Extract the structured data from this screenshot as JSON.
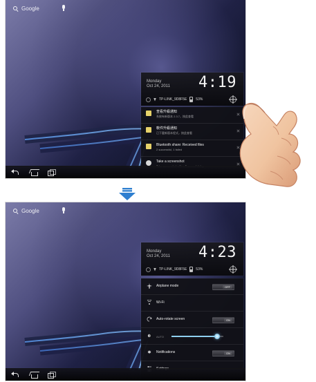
{
  "top_screen": {
    "search_label": "Google",
    "status": {
      "day": "Monday",
      "date": "Oct 24, 2011",
      "time": "4:19",
      "wifi_name": "TP-LINK_9D8F5E",
      "battery": "53%"
    },
    "notifications": [
      {
        "title": "查看升級通知",
        "subtitle": "系統有新版本 2.3.7，按此查看",
        "icon": "document-icon",
        "color": "#e7d26a"
      },
      {
        "title": "軟件升級通知",
        "subtitle": "已下載新版本程式，按此查看",
        "icon": "document-icon",
        "color": "#e7d26a"
      },
      {
        "title": "Bluetooth share: Received files",
        "subtitle": "2 successful, 1 failed",
        "icon": "download-icon",
        "color": "#e7d26a"
      },
      {
        "title": "Take a screenshot",
        "subtitle": "Take screenshot with a 5 second delay",
        "icon": "camera-icon",
        "color": "#d8d8d8"
      }
    ]
  },
  "bottom_screen": {
    "search_label": "Google",
    "status": {
      "day": "Monday",
      "date": "Oct 24, 2011",
      "time": "4:23",
      "wifi_name": "TP-LINK_9D8F5E",
      "battery": "53%"
    },
    "settings": [
      {
        "label": "Airplane mode",
        "state": "OFF",
        "icon": "airplane-icon"
      },
      {
        "label": "Wi-Fi",
        "state": "",
        "icon": "wifi-icon"
      },
      {
        "label": "Auto-rotate screen",
        "state": "ON",
        "icon": "rotate-icon"
      },
      {
        "label": "",
        "state": "",
        "icon": "brightness-icon",
        "slider": 0.88,
        "auto_label": "AUTO"
      },
      {
        "label": "Notifications",
        "state": "ON",
        "icon": "notification-bell-icon"
      },
      {
        "label": "Settings",
        "state": "",
        "icon": "settings-sliders-icon"
      }
    ]
  },
  "colors": {
    "accent": "#2f7fd0",
    "brightness": "#8fd0ef"
  }
}
